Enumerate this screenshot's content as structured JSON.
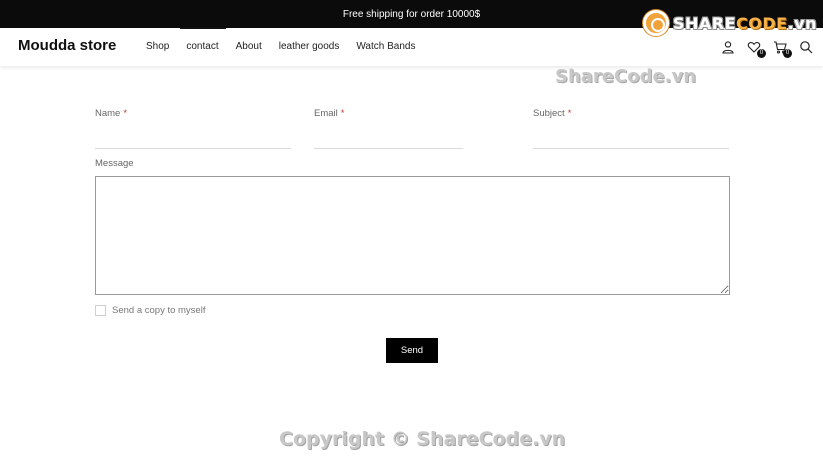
{
  "topbar": {
    "announcement": "Free shipping for order 10000$"
  },
  "header": {
    "brand": "Moudda store",
    "nav": [
      "Shop",
      "contact",
      "About",
      "leather goods",
      "Watch Bands"
    ],
    "wishlist_count": "0",
    "cart_count": "0"
  },
  "watermark": {
    "logo_prefix": "SHARE",
    "logo_suffix": "CODE",
    "logo_tld": ".vn",
    "top": "ShareCode.vn",
    "bottom": "Copyright © ShareCode.vn"
  },
  "form": {
    "name_label": "Name",
    "email_label": "Email",
    "subject_label": "Subject",
    "required_mark": "*",
    "message_label": "Message",
    "copy_label": "Send a copy to myself",
    "send_label": "Send"
  },
  "colors": {
    "topbar_bg": "#0b0b0b",
    "button_bg": "#000000",
    "required": "#c0392b"
  }
}
